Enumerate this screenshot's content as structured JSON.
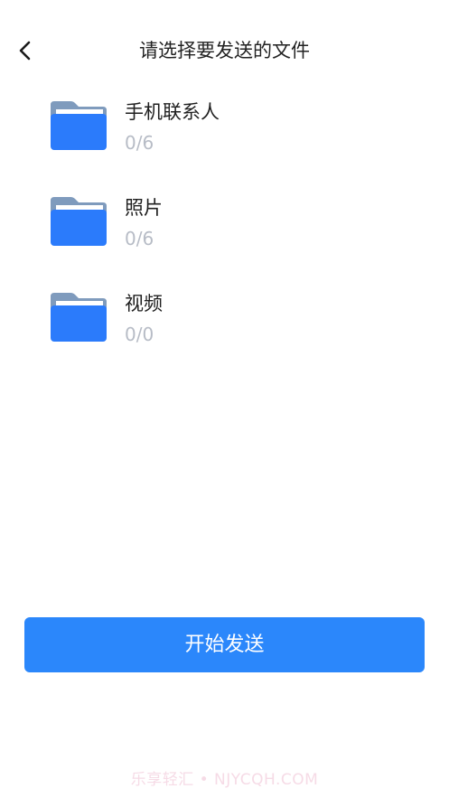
{
  "header": {
    "back_icon": "chevron-left-icon",
    "title": "请选择要发送的文件"
  },
  "files": [
    {
      "name": "手机联系人",
      "count": "0/6",
      "icon": "folder-icon"
    },
    {
      "name": "照片",
      "count": "0/6",
      "icon": "folder-icon"
    },
    {
      "name": "视频",
      "count": "0/0",
      "icon": "folder-icon"
    }
  ],
  "actions": {
    "start_label": "开始发送"
  },
  "watermark": {
    "text": "乐享轻汇 • NJYCQH.COM"
  },
  "colors": {
    "accent": "#2b87fb",
    "folder_front": "#2b7bfb",
    "folder_back": "#7f9bbd",
    "muted_text": "#b7bcc6"
  }
}
